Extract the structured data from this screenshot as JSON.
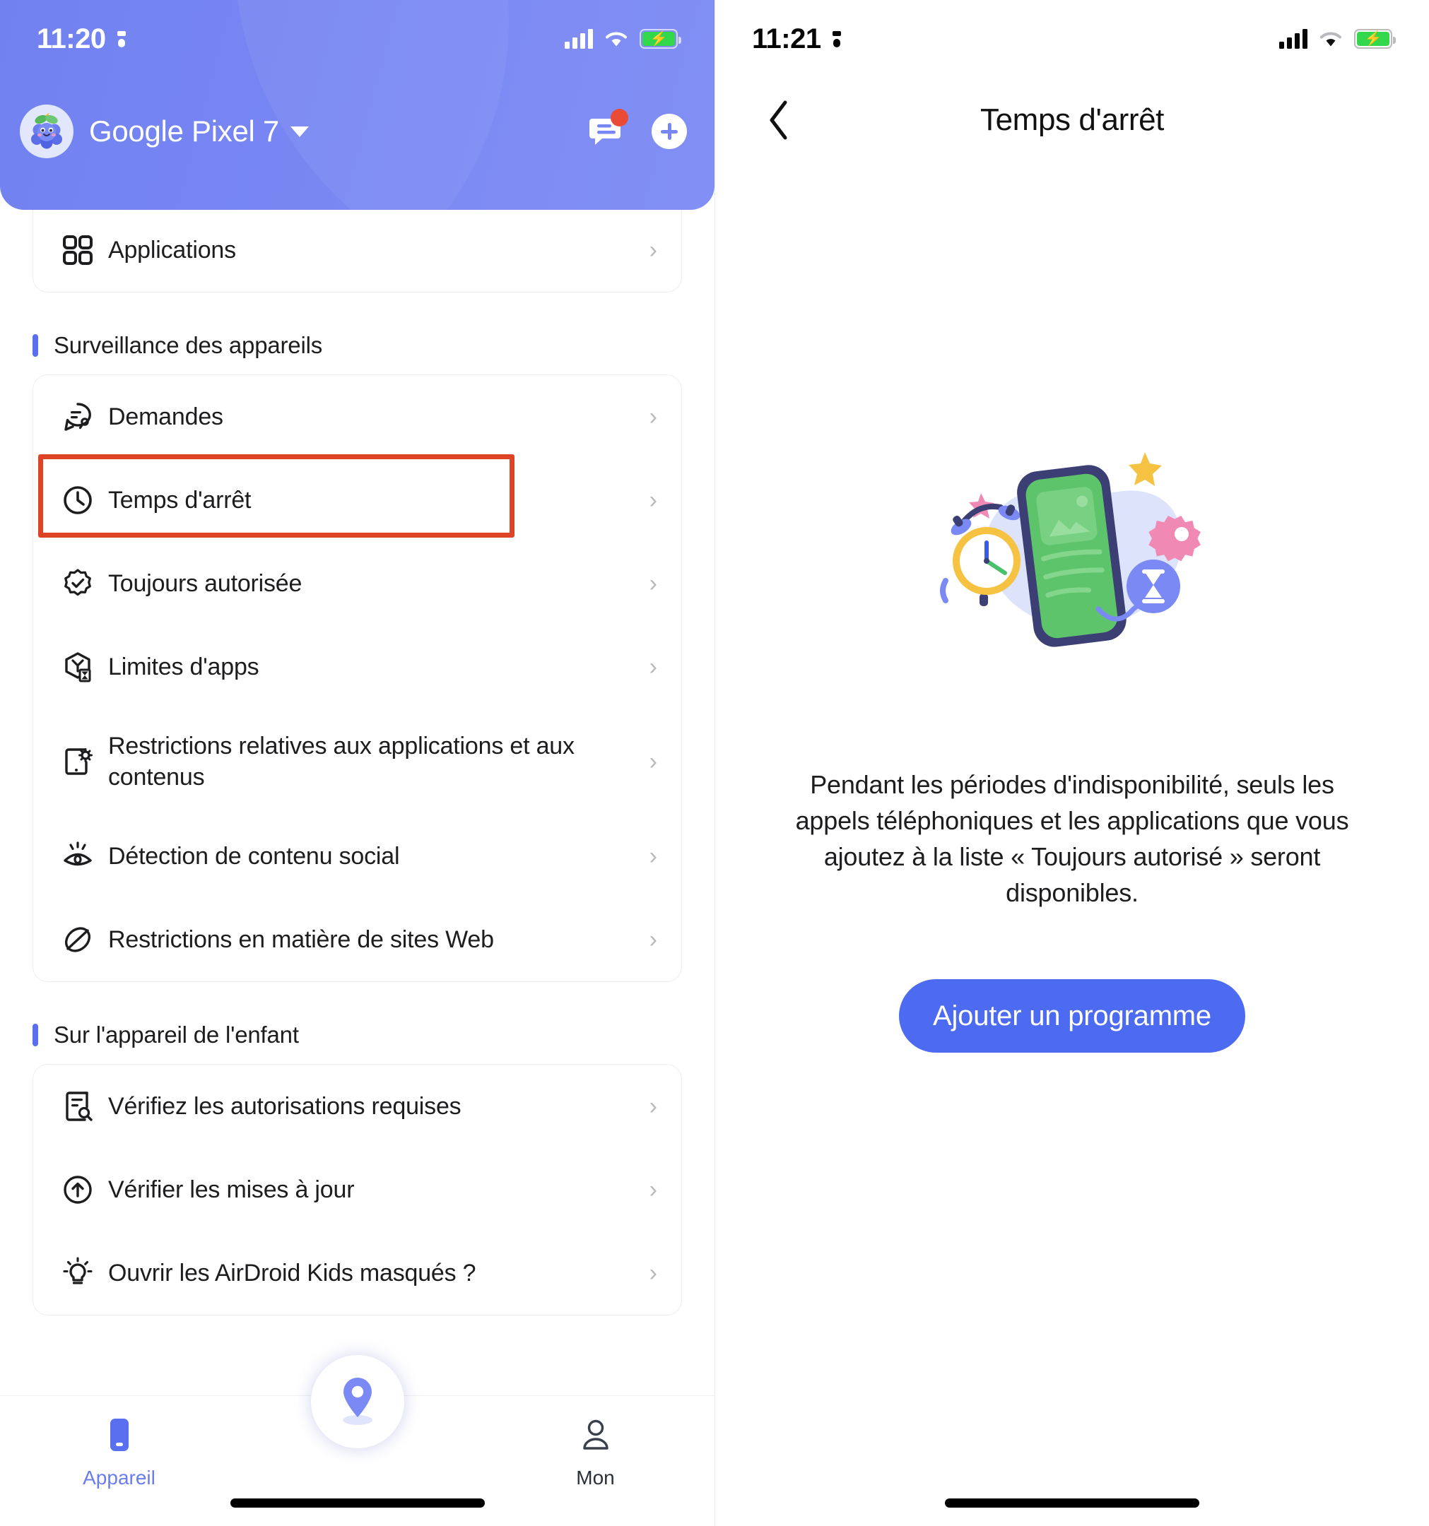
{
  "left": {
    "status": {
      "time": "11:20",
      "sim_icon": "sim-card-icon",
      "signal_icon": "cellular-signal-icon",
      "wifi_icon": "wifi-icon",
      "battery_icon": "battery-charging-icon"
    },
    "header": {
      "device_name": "Google Pixel 7",
      "avatar_name": "child-avatar-blueberry",
      "dropdown_icon": "chevron-down-icon",
      "messages_icon": "message-icon",
      "add_icon": "plus-icon",
      "has_unread_badge": true,
      "gradient_from": "#6a7cf0",
      "gradient_to": "#7b89f5"
    },
    "top_card": {
      "items": [
        {
          "label": "Applications",
          "icon": "apps-grid-icon"
        }
      ]
    },
    "sections": [
      {
        "title": "Surveillance des appareils",
        "accent": "#5a6ef0",
        "items": [
          {
            "label": "Demandes",
            "icon": "requests-icon",
            "two_line": false
          },
          {
            "label": "Temps d'arrêt",
            "icon": "clock-icon",
            "two_line": false,
            "highlighted": true
          },
          {
            "label": "Toujours autorisée",
            "icon": "badge-check-icon",
            "two_line": false
          },
          {
            "label": "Limites d'apps",
            "icon": "app-limits-icon",
            "two_line": false
          },
          {
            "label": "Restrictions relatives aux applications et aux contenus",
            "icon": "phone-settings-icon",
            "two_line": true
          },
          {
            "label": "Détection de contenu social",
            "icon": "eye-icon",
            "two_line": false
          },
          {
            "label": "Restrictions en matière de sites Web",
            "icon": "globe-blocked-icon",
            "two_line": false
          }
        ]
      },
      {
        "title": "Sur l'appareil de l'enfant",
        "accent": "#5a6ef0",
        "items": [
          {
            "label": "Vérifiez les autorisations requises",
            "icon": "document-search-icon",
            "two_line": false
          },
          {
            "label": "Vérifier les mises à jour",
            "icon": "arrow-up-circle-icon",
            "two_line": false
          },
          {
            "label": "Ouvrir les AirDroid Kids masqués ?",
            "icon": "lightbulb-icon",
            "two_line": false
          }
        ]
      }
    ],
    "chevron": "›",
    "highlight_color": "#dd4425",
    "tabs": [
      {
        "label": "Appareil",
        "icon": "device-icon",
        "active": true
      },
      {
        "label": "",
        "icon": "location-pin-icon",
        "active": false
      },
      {
        "label": "Mon",
        "icon": "person-icon",
        "active": false
      }
    ]
  },
  "right": {
    "status": {
      "time": "11:21",
      "sim_icon": "sim-card-icon",
      "signal_icon": "cellular-signal-icon",
      "wifi_icon": "wifi-icon",
      "battery_icon": "battery-charging-icon"
    },
    "header": {
      "title": "Temps d'arrêt",
      "back_icon": "chevron-left-icon"
    },
    "illustration": "downtime-phone-clock-hourglass-illustration",
    "description": "Pendant les périodes d'indisponibilité, seuls les appels téléphoniques et les applications que vous ajoutez à la liste « Toujours autorisé » seront disponibles.",
    "cta_label": "Ajouter un programme",
    "cta_color": "#4d6bf0"
  }
}
